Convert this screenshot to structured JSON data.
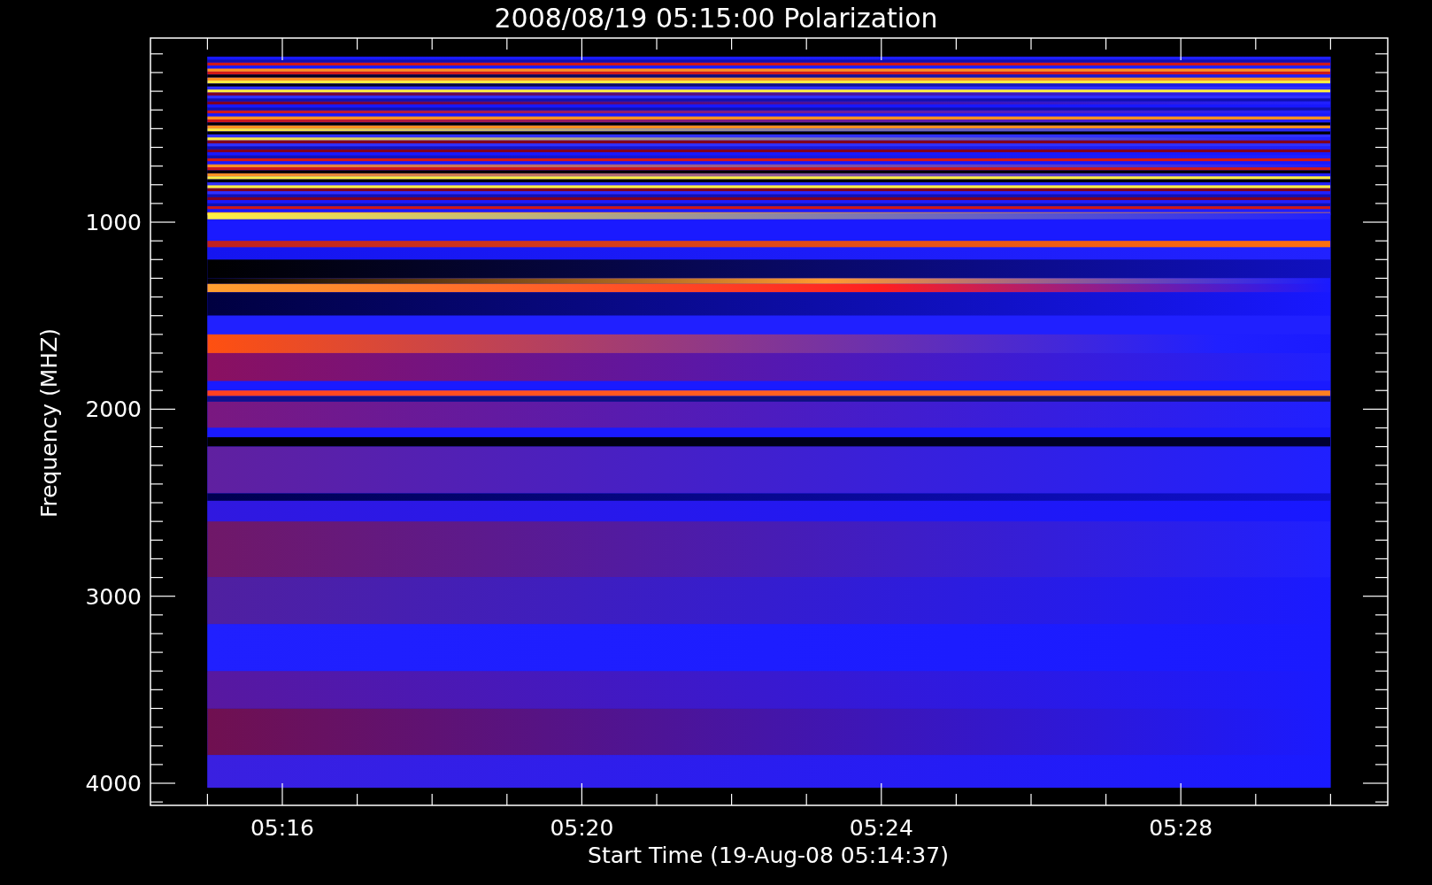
{
  "title": "2008/08/19 05:15:00 Polarization",
  "y_axis": {
    "label": "Frequency (MHZ)",
    "ticks": [
      "1000",
      "2000",
      "3000",
      "4000"
    ]
  },
  "x_axis": {
    "label": "Start Time (19-Aug-08 05:14:37)",
    "ticks": [
      "05:16",
      "05:20",
      "05:24",
      "05:28"
    ]
  }
}
